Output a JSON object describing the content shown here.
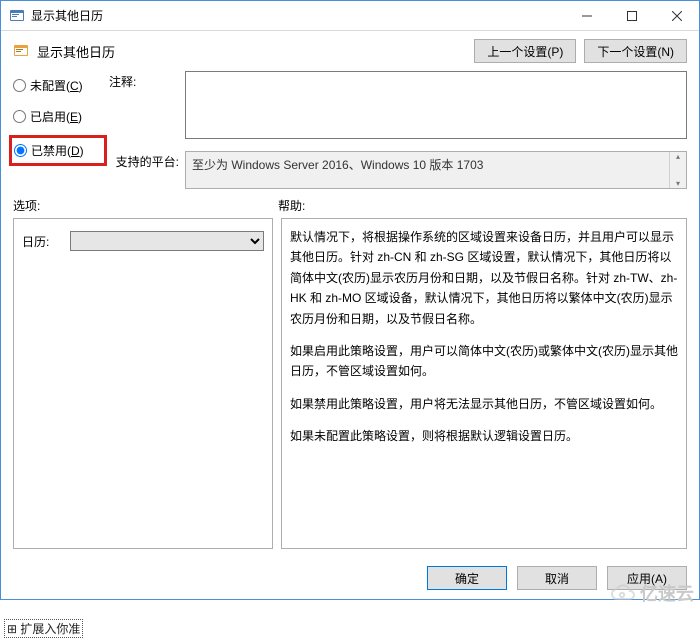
{
  "window": {
    "title": "显示其他日历",
    "minimize_tooltip": "最小化",
    "maximize_tooltip": "最大化",
    "close_tooltip": "关闭"
  },
  "header": {
    "title": "显示其他日历",
    "prev_button": "上一个设置(P)",
    "next_button": "下一个设置(N)"
  },
  "radios": {
    "not_configured": "未配置(C)",
    "enabled": "已启用(E)",
    "disabled": "已禁用(D)",
    "selected": "disabled"
  },
  "labels": {
    "notes": "注释:",
    "supported_on": "支持的平台:",
    "options": "选项:",
    "help": "帮助:",
    "calendar_option": "日历:"
  },
  "fields": {
    "notes_value": "",
    "supported_on_value": "至少为 Windows Server 2016、Windows 10 版本 1703",
    "calendar_selected": ""
  },
  "help_text": {
    "p1": "默认情况下，将根据操作系统的区域设置来设备日历，并且用户可以显示其他日历。针对 zh-CN 和 zh-SG 区域设置，默认情况下，其他日历将以简体中文(农历)显示农历月份和日期，以及节假日名称。针对 zh-TW、zh-HK 和 zh-MO 区域设备，默认情况下，其他日历将以繁体中文(农历)显示农历月份和日期，以及节假日名称。",
    "p2": "如果启用此策略设置，用户可以简体中文(农历)或繁体中文(农历)显示其他日历，不管区域设置如何。",
    "p3": "如果禁用此策略设置，用户将无法显示其他日历，不管区域设置如何。",
    "p4": "如果未配置此策略设置，则将根据默认逻辑设置日历。"
  },
  "footer": {
    "ok": "确定",
    "cancel": "取消",
    "apply": "应用(A)"
  },
  "truncated": "扩展入你准",
  "watermark": "亿速云"
}
